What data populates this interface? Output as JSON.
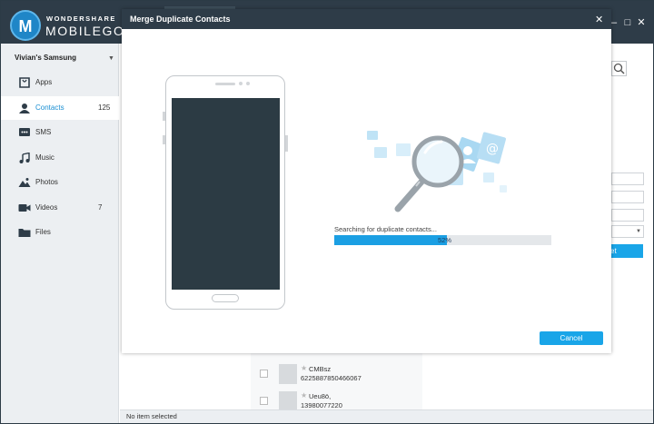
{
  "app": {
    "brand_top": "WONDERSHARE",
    "brand_main": "MOBILEGO",
    "logo_letter": "M",
    "window_controls": {
      "minimize": "–",
      "maximize": "□",
      "close": "✕"
    }
  },
  "sidebar": {
    "device": "Vivian's Samsung",
    "items": [
      {
        "label": "Apps",
        "count": "",
        "icon": "apps-icon"
      },
      {
        "label": "Contacts",
        "count": "125",
        "icon": "person-icon",
        "active": true
      },
      {
        "label": "SMS",
        "count": "",
        "icon": "sms-icon"
      },
      {
        "label": "Music",
        "count": "",
        "icon": "music-icon"
      },
      {
        "label": "Photos",
        "count": "",
        "icon": "photos-icon"
      },
      {
        "label": "Videos",
        "count": "7",
        "icon": "video-icon"
      },
      {
        "label": "Files",
        "count": "",
        "icon": "folder-icon"
      }
    ]
  },
  "background": {
    "button_fragment": "et",
    "contacts": [
      {
        "name": "CMBsz",
        "number": "6225887850466067"
      },
      {
        "name": "Ueu8ö,",
        "number": "13980077220"
      }
    ],
    "status": "No item selected"
  },
  "modal": {
    "title": "Merge Duplicate Contacts",
    "close": "✕",
    "progress_label": "Searching for duplicate contacts...",
    "progress_percent": 52,
    "progress_text": "52%",
    "cancel": "Cancel"
  },
  "colors": {
    "titlebar": "#2e3c48",
    "accent": "#19a5e8",
    "sidebar": "#eceff2"
  }
}
